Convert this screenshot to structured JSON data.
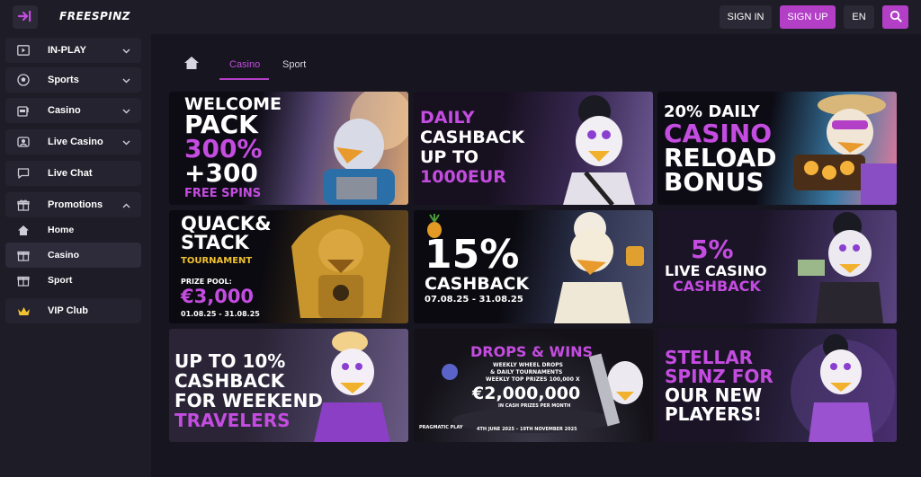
{
  "header": {
    "logo": "FREESPINZ",
    "signin_label": "SIGN IN",
    "signup_label": "SIGN UP",
    "lang_label": "EN"
  },
  "sidebar": {
    "items": [
      {
        "label": "IN-PLAY"
      },
      {
        "label": "Sports"
      },
      {
        "label": "Casino"
      },
      {
        "label": "Live Casino"
      },
      {
        "label": "Live Chat"
      },
      {
        "label": "Promotions"
      }
    ],
    "promo_sub": [
      {
        "label": "Home"
      },
      {
        "label": "Casino"
      },
      {
        "label": "Sport"
      }
    ],
    "vip": {
      "label": "VIP Club"
    }
  },
  "tabs": [
    {
      "label": "Casino"
    },
    {
      "label": "Sport"
    }
  ],
  "colors": {
    "accent": "#b23fc6",
    "background": "#1e1c26",
    "panel": "#171520"
  },
  "promos": [
    {
      "lines": [
        "WELCOME",
        "PACK",
        "300%",
        "+300",
        "FREE SPINS"
      ]
    },
    {
      "lines": [
        "DAILY",
        "CASHBACK",
        "UP TO",
        "1000EUR"
      ]
    },
    {
      "lines": [
        "20% DAILY",
        "CASINO",
        "RELOAD",
        "BONUS"
      ]
    },
    {
      "lines": [
        "QUACK&",
        "STACK",
        "TOURNAMENT",
        "PRIZE POOL:",
        "€3,000",
        "01.08.25 - 31.08.25"
      ]
    },
    {
      "lines": [
        "15%",
        "CASHBACK",
        "07.08.25 - 31.08.25"
      ]
    },
    {
      "lines": [
        "5%",
        "LIVE CASINO",
        "CASHBACK"
      ]
    },
    {
      "lines": [
        "UP TO 10%",
        "CASHBACK",
        "FOR WEEKEND",
        "TRAVELERS"
      ]
    },
    {
      "lines": [
        "DROPS & WINS",
        "WEEKLY WHEEL DROPS",
        "& DAILY TOURNAMENTS",
        "WEEKLY TOP PRIZES 100,000 X",
        "€2,000,000",
        "IN CASH PRIZES PER MONTH",
        "4TH JUNE 2025 – 19TH NOVEMBER 2025",
        "PRAGMATIC PLAY"
      ]
    },
    {
      "lines": [
        "STELLAR",
        "SPINZ FOR",
        "OUR NEW",
        "PLAYERS!"
      ]
    }
  ]
}
